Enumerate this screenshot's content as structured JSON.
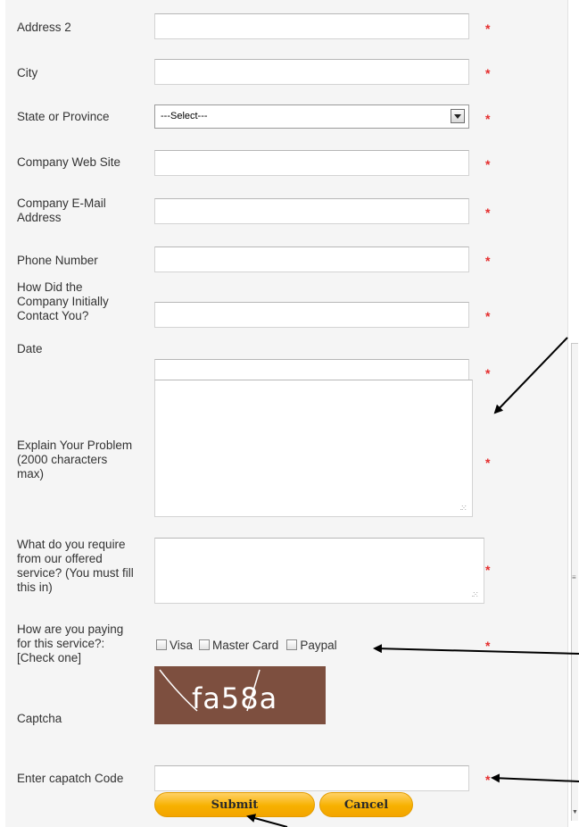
{
  "form": {
    "required_marker": "*",
    "fields": {
      "address2": {
        "label": "Address 2",
        "value": ""
      },
      "city": {
        "label": "City",
        "value": ""
      },
      "state": {
        "label": "State or Province",
        "selected": "---Select---"
      },
      "website": {
        "label": "Company Web Site",
        "value": ""
      },
      "email": {
        "label_line1": "Company E-Mail",
        "label_line2": "Address",
        "value": ""
      },
      "phone": {
        "label": "Phone Number",
        "value": ""
      },
      "contact": {
        "label_line1": "How Did the",
        "label_line2": "Company Initially",
        "label_line3": "Contact You?",
        "value": ""
      },
      "date": {
        "label": "Date",
        "value": ""
      },
      "problem": {
        "label_line1": "Explain Your Problem",
        "label_line2": "(2000 characters",
        "label_line3": "max)",
        "value": ""
      },
      "require": {
        "label_line1": "What do you require",
        "label_line2": "from our offered",
        "label_line3": "service? (You must fill",
        "label_line4": "this in)",
        "value": ""
      },
      "payment": {
        "label_line1": "How are you paying",
        "label_line2": "for this service?:",
        "label_line3": "[Check one]",
        "options": [
          "Visa",
          "Master Card",
          "Paypal"
        ]
      },
      "captcha": {
        "label": "Captcha",
        "image_text": "fa58a"
      },
      "captcha_code": {
        "label": "Enter capatch Code",
        "value": ""
      }
    },
    "buttons": {
      "submit": "Submit",
      "cancel": "Cancel"
    }
  },
  "colors": {
    "panel_bg": "#f5f5f5",
    "required": "#e52d2d",
    "button": "#f7b100",
    "captcha_bg": "#7d4f3f"
  }
}
